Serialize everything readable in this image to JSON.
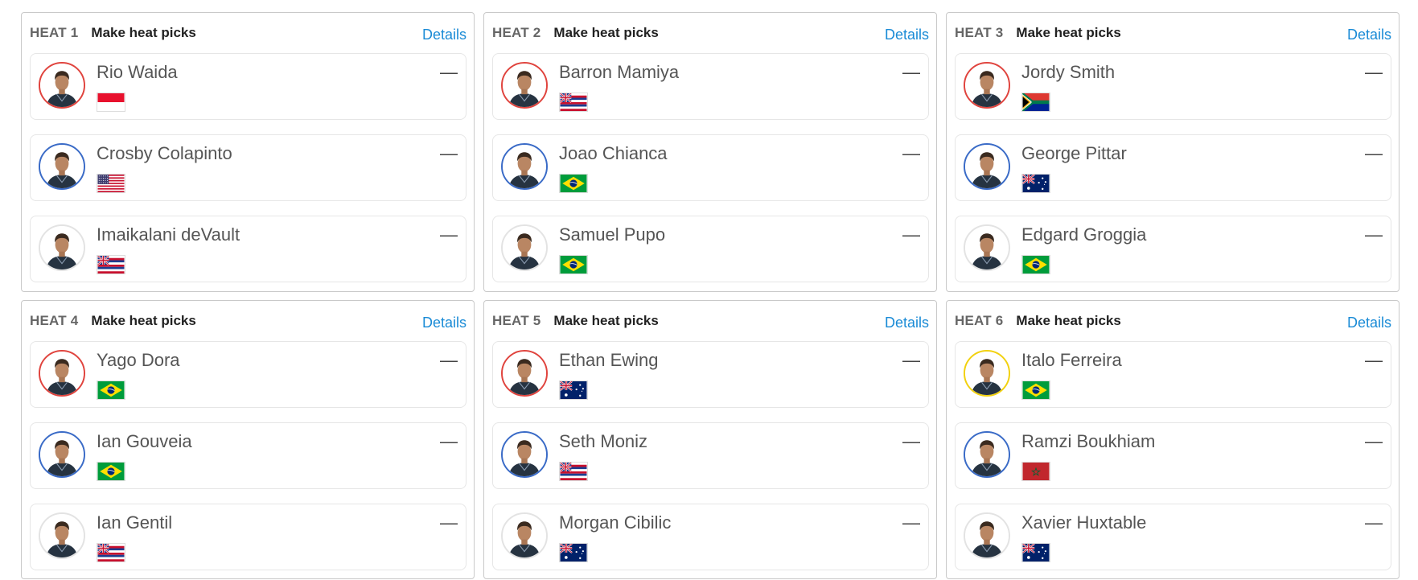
{
  "heats": [
    {
      "label": "HEAT 1",
      "picks_label": "Make heat picks",
      "details_label": "Details",
      "surfers": [
        {
          "name": "Rio Waida",
          "flag": "indonesia-flag",
          "ring": "#e0443e",
          "score": "—"
        },
        {
          "name": "Crosby Colapinto",
          "flag": "usa-flag",
          "ring": "#3a6bc7",
          "score": "—"
        },
        {
          "name": "Imaikalani deVault",
          "flag": "hawaii-flag",
          "ring": "#e3e3e3",
          "score": "—"
        }
      ]
    },
    {
      "label": "HEAT 2",
      "picks_label": "Make heat picks",
      "details_label": "Details",
      "surfers": [
        {
          "name": "Barron Mamiya",
          "flag": "hawaii-flag",
          "ring": "#e0443e",
          "score": "—"
        },
        {
          "name": "Joao Chianca",
          "flag": "brazil-flag",
          "ring": "#3a6bc7",
          "score": "—"
        },
        {
          "name": "Samuel Pupo",
          "flag": "brazil-flag",
          "ring": "#e3e3e3",
          "score": "—"
        }
      ]
    },
    {
      "label": "HEAT 3",
      "picks_label": "Make heat picks",
      "details_label": "Details",
      "surfers": [
        {
          "name": "Jordy Smith",
          "flag": "south-africa-flag",
          "ring": "#e0443e",
          "score": "—"
        },
        {
          "name": "George Pittar",
          "flag": "australia-flag",
          "ring": "#3a6bc7",
          "score": "—"
        },
        {
          "name": "Edgard Groggia",
          "flag": "brazil-flag",
          "ring": "#e3e3e3",
          "score": "—"
        }
      ]
    },
    {
      "label": "HEAT 4",
      "picks_label": "Make heat picks",
      "details_label": "Details",
      "surfers": [
        {
          "name": "Yago Dora",
          "flag": "brazil-flag",
          "ring": "#e0443e",
          "score": "—"
        },
        {
          "name": "Ian Gouveia",
          "flag": "brazil-flag",
          "ring": "#3a6bc7",
          "score": "—"
        },
        {
          "name": "Ian Gentil",
          "flag": "hawaii-flag",
          "ring": "#e3e3e3",
          "score": "—"
        }
      ]
    },
    {
      "label": "HEAT 5",
      "picks_label": "Make heat picks",
      "details_label": "Details",
      "surfers": [
        {
          "name": "Ethan Ewing",
          "flag": "australia-flag",
          "ring": "#e0443e",
          "score": "—"
        },
        {
          "name": "Seth Moniz",
          "flag": "hawaii-flag",
          "ring": "#3a6bc7",
          "score": "—"
        },
        {
          "name": "Morgan Cibilic",
          "flag": "australia-flag",
          "ring": "#e3e3e3",
          "score": "—"
        }
      ]
    },
    {
      "label": "HEAT 6",
      "picks_label": "Make heat picks",
      "details_label": "Details",
      "surfers": [
        {
          "name": "Italo Ferreira",
          "flag": "brazil-flag",
          "ring": "#f2d10e",
          "score": "—"
        },
        {
          "name": "Ramzi Boukhiam",
          "flag": "morocco-flag",
          "ring": "#3a6bc7",
          "score": "—"
        },
        {
          "name": "Xavier Huxtable",
          "flag": "australia-flag",
          "ring": "#e3e3e3",
          "score": "—"
        }
      ]
    }
  ]
}
